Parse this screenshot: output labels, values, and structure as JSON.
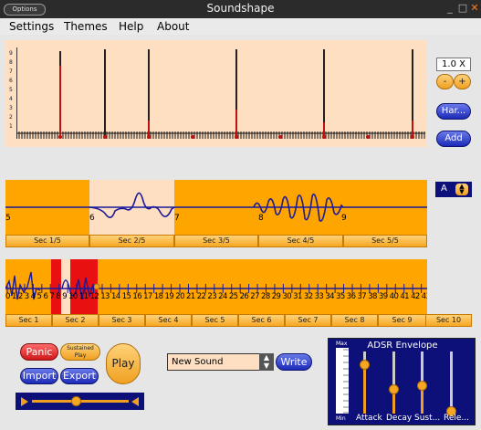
{
  "window": {
    "title": "Soundshape",
    "options_label": "Options",
    "min": "_",
    "max": "□",
    "close": "✕"
  },
  "menu": {
    "items": [
      "Settings",
      "Themes",
      "Help",
      "About"
    ]
  },
  "harmonics": {
    "y_labels": [
      "9",
      "8",
      "7",
      "6",
      "5",
      "4",
      "3",
      "2",
      "1"
    ],
    "zoom_value": "1.0 X",
    "minus_label": "-",
    "plus_label": "+",
    "harmonic_button": "Har...",
    "add_button": "Add"
  },
  "waveform": {
    "markers": [
      "5",
      "6",
      "7",
      "8",
      "9"
    ],
    "sections": [
      "Sec 1/5",
      "Sec 2/5",
      "Sec 3/5",
      "Sec 4/5",
      "Sec 5/5"
    ],
    "channel_label": "A"
  },
  "timeline": {
    "numbers": "0 1 2 3 4 5 6 7 8 9 10 11 12 13 14 15 16 17 18 19 20 21 22 23 24 25 26 27 28 29 30 31 32 33 34 35 36 37 38 39 40 41 42 43 44 45 46 47 48",
    "sections": [
      "Sec 1",
      "Sec 2",
      "Sec 3",
      "Sec 4",
      "Sec 5",
      "Sec 6",
      "Sec 7",
      "Sec 8",
      "Sec 9",
      "Sec 10"
    ]
  },
  "controls": {
    "panic": "Panic",
    "sustained_line1": "Sustained",
    "sustained_line2": "Play",
    "import": "Import",
    "export": "Export",
    "play": "Play",
    "sound_name": "New Sound",
    "write": "Write",
    "volume_level": 0.45
  },
  "adsr": {
    "title": "ADSR Envelope",
    "scale_top": "Max",
    "scale_bottom": "Min",
    "labels": [
      "Attack",
      "Decay",
      "Sust...",
      "Rele..."
    ],
    "levels": [
      0.8,
      0.4,
      0.45,
      0.05
    ]
  },
  "colors": {
    "accent": "#ffa500",
    "panel": "#ffdfc2",
    "navy": "#0c1078",
    "wave": "#1a1a9a"
  }
}
